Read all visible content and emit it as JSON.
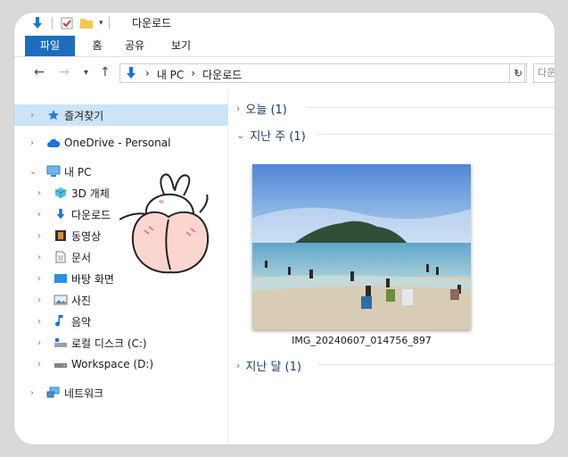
{
  "window": {
    "title": "다운로드"
  },
  "ribbon": {
    "tabs": [
      "파일",
      "홈",
      "공유",
      "보기"
    ]
  },
  "address": {
    "crumbs": [
      "내 PC",
      "다운로드"
    ],
    "search_placeholder": "다운로"
  },
  "sidebar": {
    "items": [
      {
        "label": "즐겨찾기",
        "icon": "star-icon"
      },
      {
        "label": "OneDrive - Personal",
        "icon": "cloud-icon"
      },
      {
        "label": "내 PC",
        "icon": "computer-icon"
      },
      {
        "label": "3D 개체",
        "icon": "cube-icon"
      },
      {
        "label": "다운로드",
        "icon": "download-arrow-icon"
      },
      {
        "label": "동영상",
        "icon": "film-icon"
      },
      {
        "label": "문서",
        "icon": "document-icon"
      },
      {
        "label": "바탕 화면",
        "icon": "desktop-icon"
      },
      {
        "label": "사진",
        "icon": "picture-icon"
      },
      {
        "label": "음악",
        "icon": "music-note-icon"
      },
      {
        "label": "로컬 디스크 (C:)",
        "icon": "drive-icon"
      },
      {
        "label": "Workspace (D:)",
        "icon": "drive-icon"
      },
      {
        "label": "네트워크",
        "icon": "network-icon"
      }
    ]
  },
  "content": {
    "groups": [
      {
        "label": "오늘 (1)",
        "expanded": false
      },
      {
        "label": "지난 주 (1)",
        "expanded": true
      },
      {
        "label": "지난 달 (1)",
        "expanded": false
      }
    ],
    "file": {
      "name": "IMG_20240607_014756_897"
    }
  },
  "colors": {
    "accent": "#1c6ebd",
    "selected": "#cce4f7",
    "group_text": "#1e3a6e"
  }
}
